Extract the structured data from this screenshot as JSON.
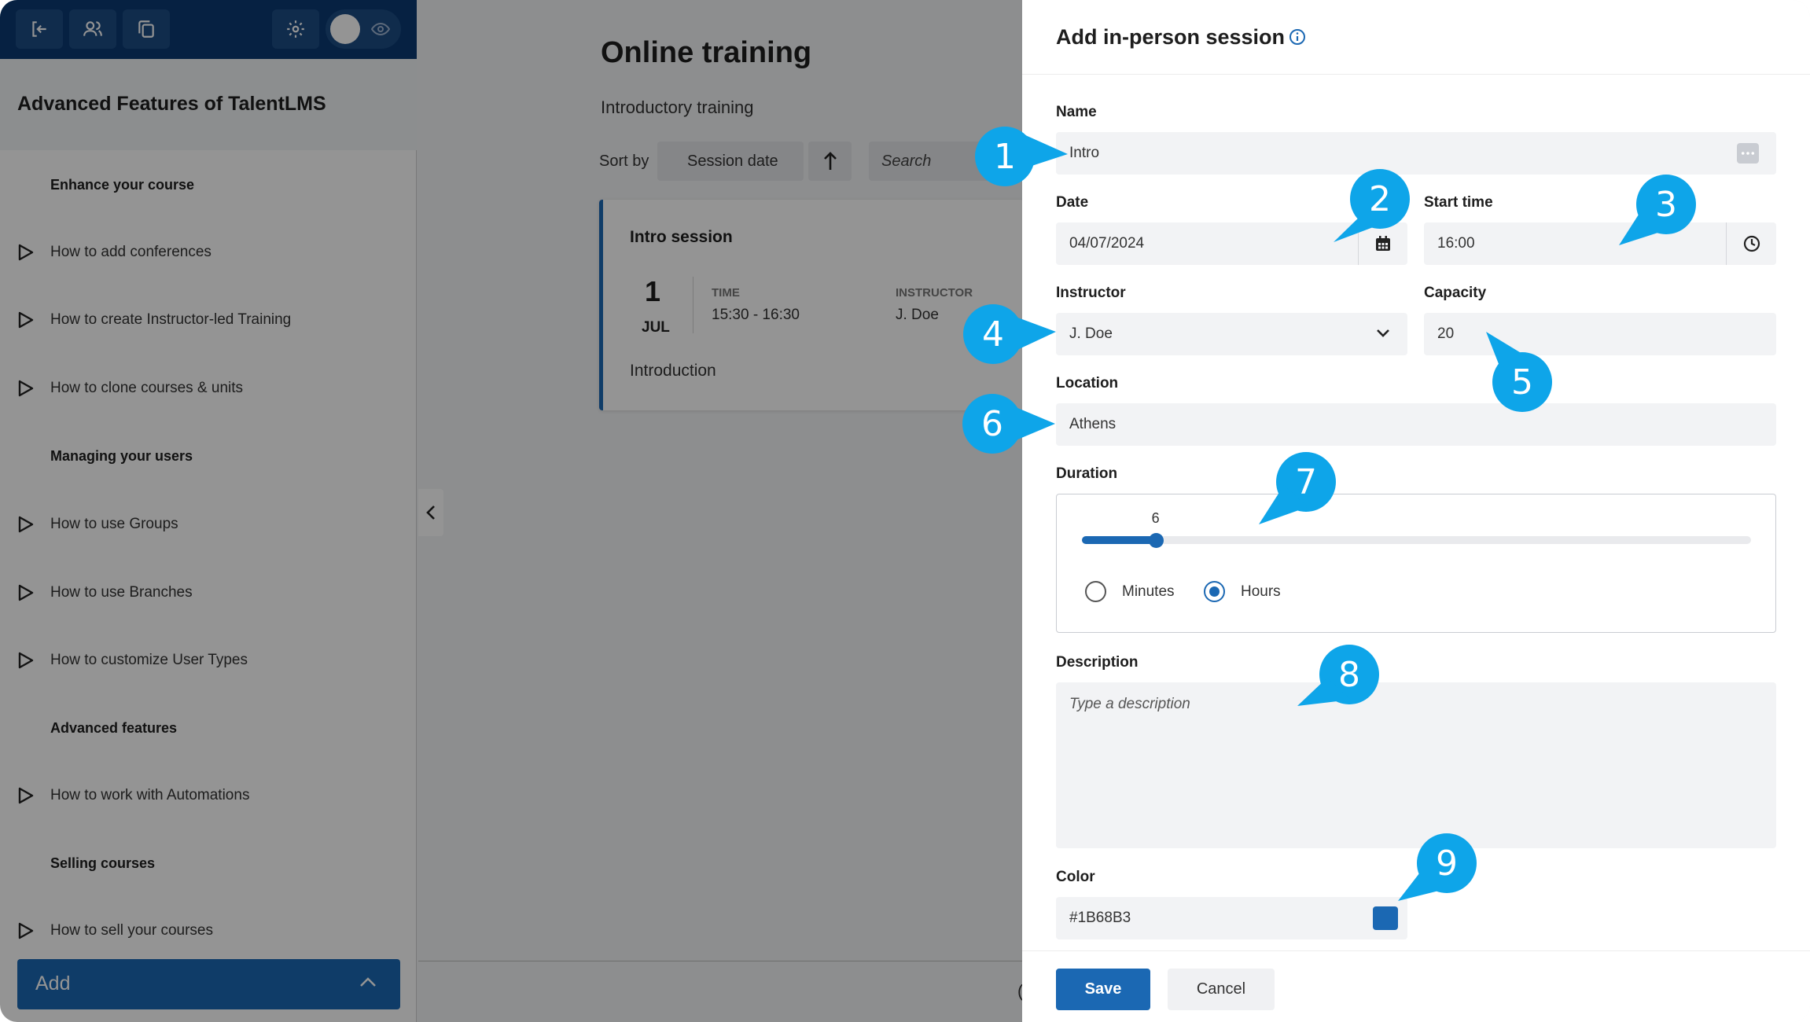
{
  "colors": {
    "accent": "#1B68B3",
    "callout": "#0EA5E9",
    "topbar": "#0B3A72"
  },
  "sidebar": {
    "course_title": "Advanced Features of TalentLMS",
    "toolbar_icons": [
      "exit-icon",
      "users-icon",
      "copy-icon",
      "gear-icon",
      "eye-icon"
    ],
    "sections": [
      {
        "title": "Enhance your course",
        "units": [
          "How to add conferences",
          "How to create Instructor-led Training",
          "How to clone courses & units"
        ]
      },
      {
        "title": "Managing your users",
        "units": [
          "How to use Groups",
          "How to use Branches",
          "How to customize User Types"
        ]
      },
      {
        "title": "Advanced features",
        "units": [
          "How to work with Automations"
        ]
      },
      {
        "title": "Selling courses",
        "units": [
          "How to sell your courses"
        ]
      }
    ],
    "add_label": "Add"
  },
  "main": {
    "title": "Online training",
    "subtitle": "Introductory training",
    "sort_label": "Sort by",
    "sort_value": "Session date",
    "search_placeholder": "Search",
    "session": {
      "title": "Intro session",
      "day": "1",
      "month": "JUL",
      "time_label": "TIME",
      "time_value": "15:30 - 16:30",
      "instructor_label": "INSTRUCTOR",
      "instructor_value": "J. Doe",
      "description": "Introduction"
    },
    "bottom_glyph": "("
  },
  "drawer": {
    "title": "Add in-person session",
    "name": {
      "label": "Name",
      "value": "Intro"
    },
    "date": {
      "label": "Date",
      "value": "04/07/2024"
    },
    "start_time": {
      "label": "Start time",
      "value": "16:00"
    },
    "instructor": {
      "label": "Instructor",
      "value": "J. Doe"
    },
    "capacity": {
      "label": "Capacity",
      "value": "20"
    },
    "location": {
      "label": "Location",
      "value": "Athens"
    },
    "duration": {
      "label": "Duration",
      "value": "6",
      "slider_fraction": 0.11,
      "unit_options": [
        "Minutes",
        "Hours"
      ],
      "selected_unit": "Hours"
    },
    "description": {
      "label": "Description",
      "placeholder": "Type a description"
    },
    "color": {
      "label": "Color",
      "value": "#1B68B3"
    },
    "save_label": "Save",
    "cancel_label": "Cancel"
  },
  "callouts": [
    "1",
    "2",
    "3",
    "4",
    "5",
    "6",
    "7",
    "8",
    "9"
  ]
}
